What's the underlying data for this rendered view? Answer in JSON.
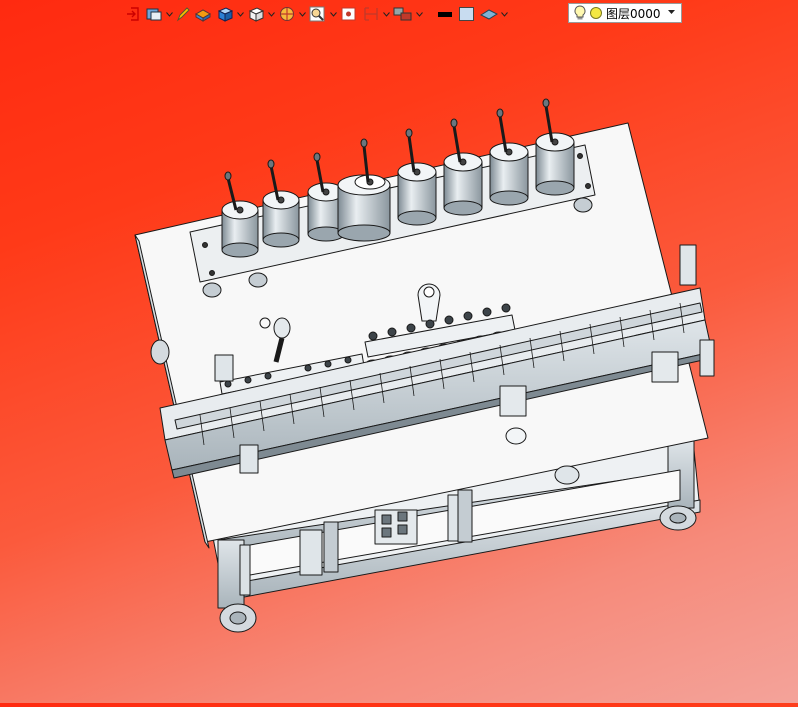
{
  "toolbar": {
    "layer_select": {
      "value": "图层0000"
    }
  },
  "colors": {
    "background_top": "#ff2a10",
    "background_bottom": "#f4a39a",
    "model_metal": "#c9d2d8",
    "model_line": "#1a1a1a",
    "plate_white": "#f8f8f8"
  }
}
